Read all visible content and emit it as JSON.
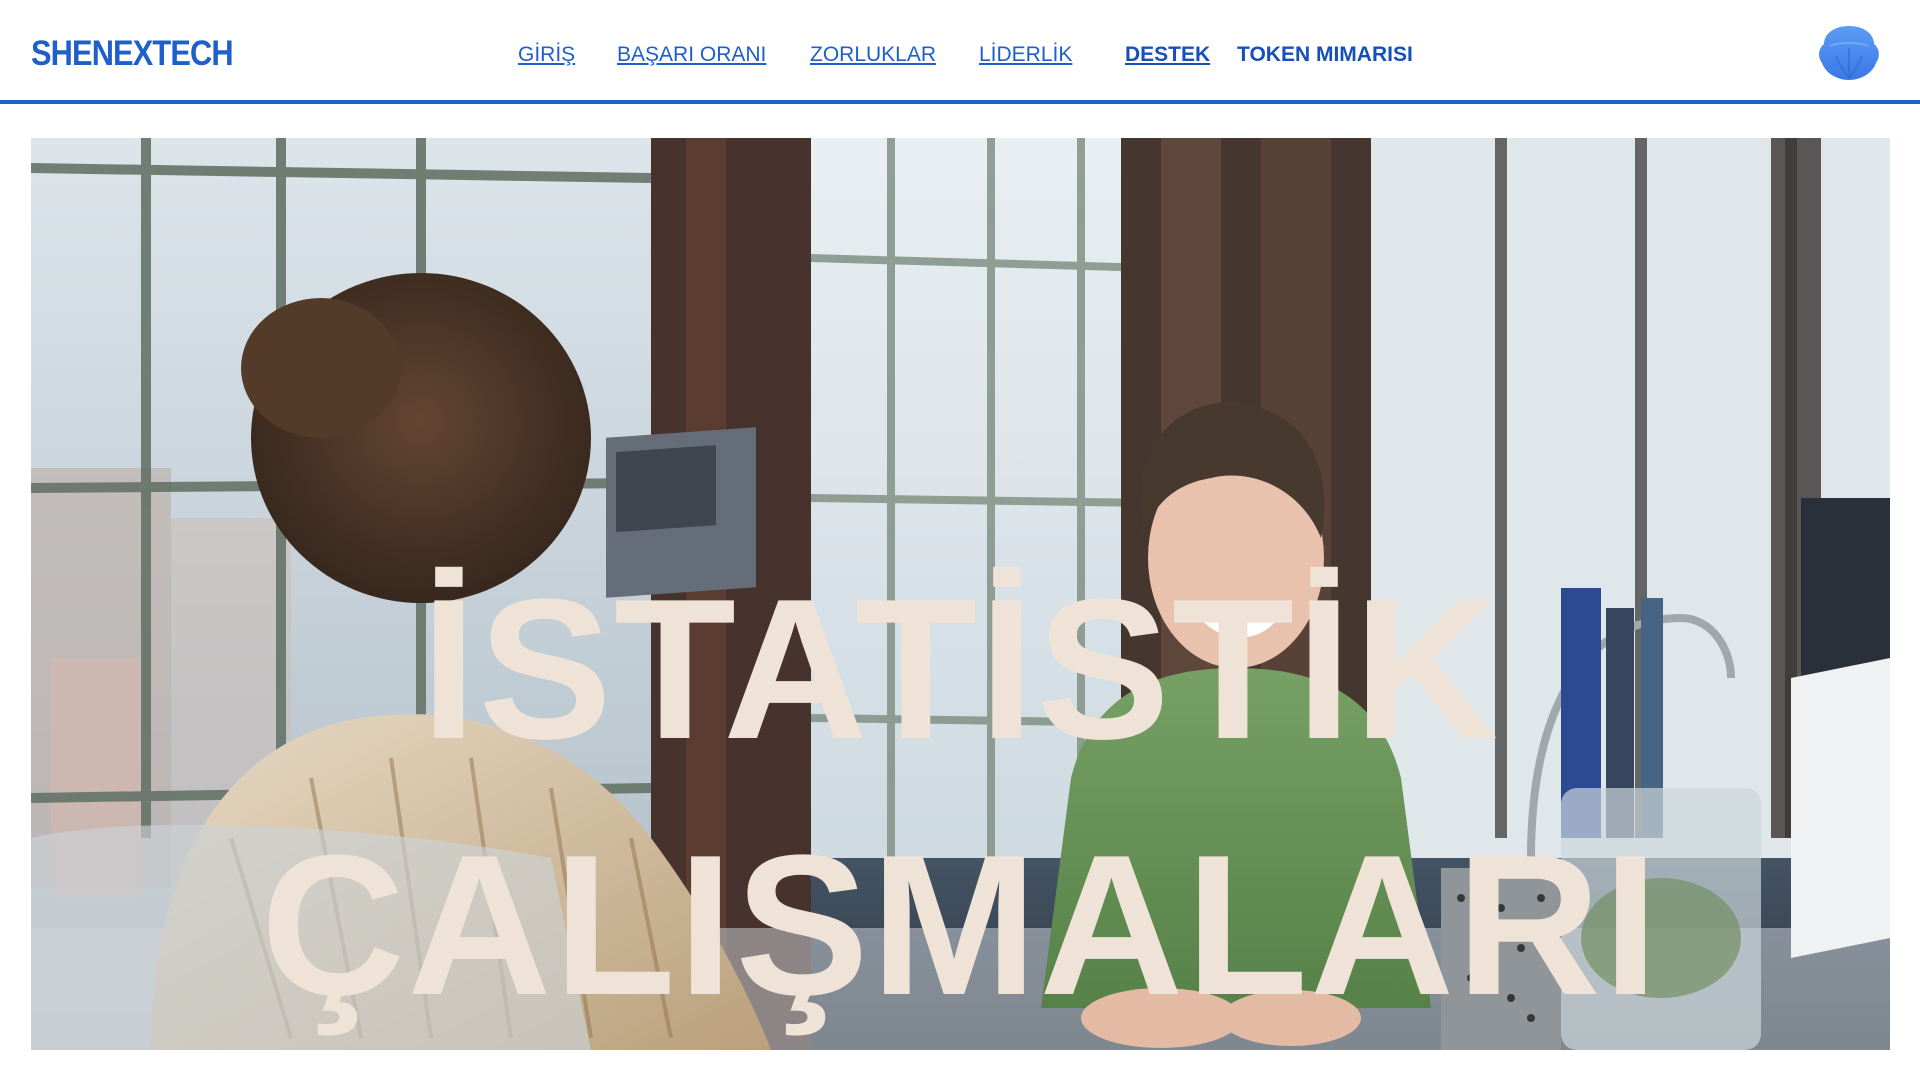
{
  "brand": {
    "name": "SHENEXTECH"
  },
  "nav": {
    "items": [
      {
        "label": "GİRİŞ"
      },
      {
        "label": "BAŞARI ORANI"
      },
      {
        "label": "ZORLUKLAR"
      },
      {
        "label": "LİDERLİK"
      },
      {
        "label": "DESTEK"
      },
      {
        "label": "TOKEN MIMARISI"
      }
    ]
  },
  "hero": {
    "title_line1": "İSTATİSTİK",
    "title_line2": "ÇALIŞMALARI"
  },
  "colors": {
    "accent": "#1f5fc9",
    "hero_text": "#efe3d8",
    "logo_blue": "#4a8ff0"
  },
  "icons": {
    "logo": "shell-icon"
  }
}
